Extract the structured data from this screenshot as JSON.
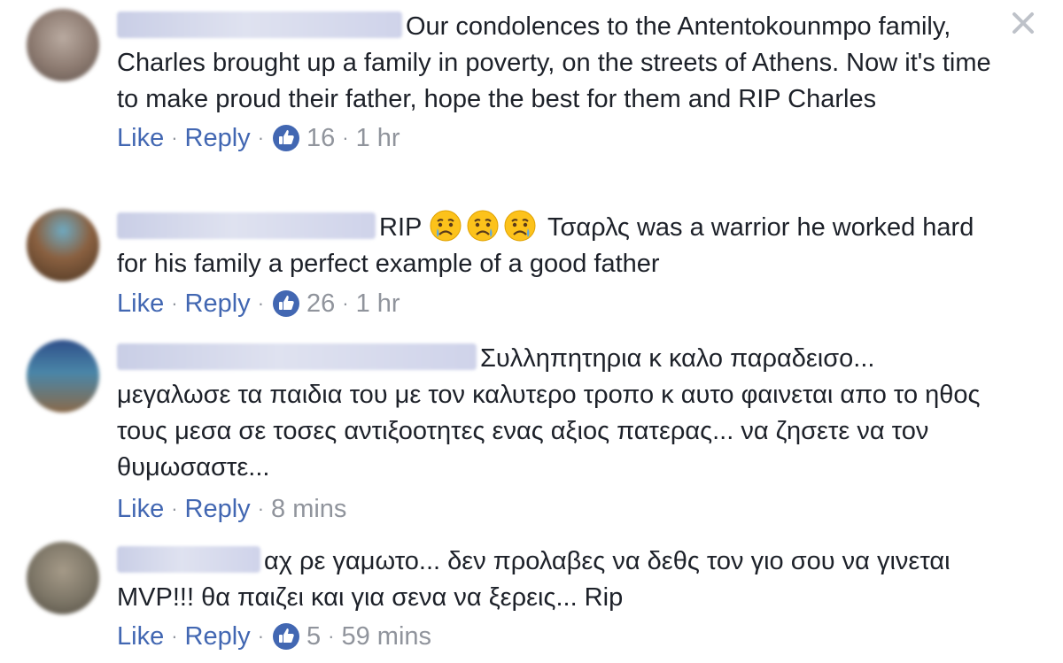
{
  "close": {
    "label": "close"
  },
  "comments": [
    {
      "text": "Our condolences to the Antentokounmpo family, Charles brought up a family in poverty, on the streets of Athens. Now it's time to make proud their father, hope the best for them and RIP Charles",
      "like_label": "Like",
      "reply_label": "Reply",
      "sep": "·",
      "likes": "16",
      "time": "1 hr",
      "avatar_color": "#8c7a70"
    },
    {
      "text_before": "RIP",
      "emoji": "crying-face-icon",
      "text": "Τσαρλς was a warrior he worked hard for his family a perfect example of a good father",
      "like_label": "Like",
      "reply_label": "Reply",
      "sep": "·",
      "likes": "26",
      "time": "1 hr",
      "avatar_color": "#7a5a40"
    },
    {
      "text": "Συλληπητηρια κ καλο παραδεισο... μεγαλωσε τα παιδια του με τον καλυτερο τροπο κ αυτο φαινεται απο το ηθος τους μεσα σε τοσες αντιξοοτητες ενας αξιος πατερας... να ζησετε να τον θυμωσαστε...",
      "like_label": "Like",
      "reply_label": "Reply",
      "sep": "·",
      "time": "8 mins",
      "avatar_color": "#3b6d8a"
    },
    {
      "text": "αχ ρε γαμωτο... δεν προλαβες να δεθς τον γιο σου να γινεται MVP!!! θα παιζει και για σενα να ξερεις... Rip",
      "like_label": "Like",
      "reply_label": "Reply",
      "sep": "·",
      "likes": "5",
      "time": "59 mins",
      "avatar_color": "#7c7566"
    }
  ],
  "colors": {
    "text": "#1d2129",
    "link": "#4267b2",
    "meta": "#90949c",
    "like_badge": "#4267b2"
  }
}
